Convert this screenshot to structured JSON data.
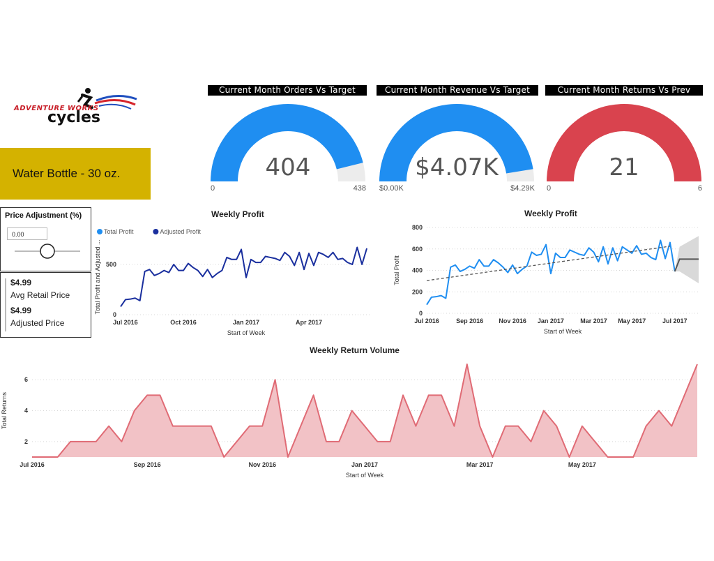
{
  "logo": {
    "line1": "ADVENTURE WORKS",
    "line2": "cycles"
  },
  "product": {
    "title": "Water Bottle - 30 oz."
  },
  "gauges": [
    {
      "title": "Current Month Orders Vs Target",
      "value_text": "404",
      "min_label": "0",
      "max_label": "438",
      "fraction": 0.922,
      "color": "#1f8ef1"
    },
    {
      "title": "Current Month Revenue Vs Target",
      "value_text": "$4.07K",
      "min_label": "$0.00K",
      "max_label": "$4.29K",
      "fraction": 0.949,
      "color": "#1f8ef1"
    },
    {
      "title": "Current Month Returns Vs Prev Month",
      "value_text": "21",
      "min_label": "0",
      "max_label": "6",
      "fraction": 1.0,
      "color": "#d9434e"
    }
  ],
  "slicer": {
    "title": "Price Adjustment (%)",
    "value": "0.00",
    "slider_position": 0.5
  },
  "card": {
    "avg_value": "$4.99",
    "avg_label": "Avg Retail Price",
    "adj_value": "$4.99",
    "adj_label": "Adjusted Price"
  },
  "chart_data": [
    {
      "type": "line",
      "title": "Weekly Profit",
      "xlabel": "Start of Week",
      "ylabel": "Total Profit and Adjusted ...",
      "legend": [
        "Total Profit",
        "Adjusted Profit"
      ],
      "legend_colors": [
        "#1f8ef1",
        "#1a2f9e"
      ],
      "legend_position": "top-left",
      "x_ticks": [
        "Jul 2016",
        "Oct 2016",
        "Jan 2017",
        "Apr 2017"
      ],
      "y_ticks": [
        "0",
        "500"
      ],
      "ylim": [
        0,
        750
      ],
      "x_range": [
        "2016-07-04",
        "2017-07-03"
      ],
      "series": [
        {
          "name": "Adjusted Profit",
          "color": "#1a2f9e",
          "x": [
            "2016-07-04",
            "2016-07-11",
            "2016-07-18",
            "2016-07-25",
            "2016-08-01",
            "2016-08-08",
            "2016-08-15",
            "2016-08-22",
            "2016-08-29",
            "2016-09-05",
            "2016-09-12",
            "2016-09-19",
            "2016-09-26",
            "2016-10-03",
            "2016-10-10",
            "2016-10-17",
            "2016-10-24",
            "2016-10-31",
            "2016-11-07",
            "2016-11-14",
            "2016-11-21",
            "2016-11-28",
            "2016-12-05",
            "2016-12-12",
            "2016-12-19",
            "2016-12-26",
            "2017-01-02",
            "2017-01-09",
            "2017-01-16",
            "2017-01-23",
            "2017-01-30",
            "2017-02-06",
            "2017-02-13",
            "2017-02-20",
            "2017-02-27",
            "2017-03-06",
            "2017-03-13",
            "2017-03-20",
            "2017-03-27",
            "2017-04-03",
            "2017-04-10",
            "2017-04-17",
            "2017-04-24",
            "2017-05-01",
            "2017-05-08",
            "2017-05-15",
            "2017-05-22",
            "2017-05-29",
            "2017-06-05",
            "2017-06-12",
            "2017-06-19",
            "2017-06-26"
          ],
          "values": [
            80,
            150,
            155,
            165,
            140,
            430,
            450,
            390,
            410,
            440,
            420,
            500,
            440,
            440,
            510,
            470,
            440,
            380,
            450,
            370,
            410,
            440,
            570,
            550,
            550,
            650,
            370,
            550,
            520,
            520,
            580,
            570,
            560,
            540,
            620,
            580,
            490,
            620,
            450,
            610,
            490,
            620,
            600,
            570,
            620,
            550,
            560,
            520,
            500,
            670,
            500,
            660
          ]
        }
      ]
    },
    {
      "type": "line",
      "title": "Weekly Profit",
      "xlabel": "Start of Week",
      "ylabel": "Total Profit",
      "x_ticks": [
        "Jul 2016",
        "Sep 2016",
        "Nov 2016",
        "Jan 2017",
        "Mar 2017",
        "May 2017",
        "Jul 2017"
      ],
      "y_ticks": [
        "0",
        "200",
        "400",
        "600",
        "800"
      ],
      "ylim": [
        0,
        800
      ],
      "x_range": [
        "2016-07-04",
        "2017-08-07"
      ],
      "series": [
        {
          "name": "Total Profit",
          "color": "#1f8ef1",
          "x": [
            "2016-07-04",
            "2016-07-11",
            "2016-07-18",
            "2016-07-25",
            "2016-08-01",
            "2016-08-08",
            "2016-08-15",
            "2016-08-22",
            "2016-08-29",
            "2016-09-05",
            "2016-09-12",
            "2016-09-19",
            "2016-09-26",
            "2016-10-03",
            "2016-10-10",
            "2016-10-17",
            "2016-10-24",
            "2016-10-31",
            "2016-11-07",
            "2016-11-14",
            "2016-11-21",
            "2016-11-28",
            "2016-12-05",
            "2016-12-12",
            "2016-12-19",
            "2016-12-26",
            "2017-01-02",
            "2017-01-09",
            "2017-01-16",
            "2017-01-23",
            "2017-01-30",
            "2017-02-06",
            "2017-02-13",
            "2017-02-20",
            "2017-02-27",
            "2017-03-06",
            "2017-03-13",
            "2017-03-20",
            "2017-03-27",
            "2017-04-03",
            "2017-04-10",
            "2017-04-17",
            "2017-04-24",
            "2017-05-01",
            "2017-05-08",
            "2017-05-15",
            "2017-05-22",
            "2017-05-29",
            "2017-06-05",
            "2017-06-12",
            "2017-06-19",
            "2017-06-26",
            "2017-07-03"
          ],
          "values": [
            80,
            150,
            155,
            165,
            140,
            430,
            450,
            390,
            410,
            440,
            420,
            500,
            440,
            440,
            500,
            470,
            430,
            380,
            450,
            370,
            410,
            440,
            570,
            540,
            550,
            640,
            370,
            560,
            520,
            520,
            590,
            570,
            550,
            540,
            610,
            570,
            480,
            620,
            460,
            610,
            490,
            620,
            590,
            560,
            630,
            550,
            560,
            520,
            500,
            680,
            510,
            660,
            390
          ]
        },
        {
          "name": "Trend",
          "style": "dashed",
          "color": "#555555",
          "x": [
            "2016-07-04",
            "2017-06-26"
          ],
          "values": [
            305,
            625
          ]
        },
        {
          "name": "Forecast",
          "color": "#555555",
          "x": [
            "2017-07-03",
            "2017-07-10",
            "2017-08-07"
          ],
          "values": [
            390,
            505,
            505
          ],
          "band_upper": [
            390,
            620,
            720
          ],
          "band_lower": [
            390,
            390,
            280
          ]
        }
      ]
    },
    {
      "type": "area",
      "title": "Weekly Return Volume",
      "xlabel": "Start of Week",
      "ylabel": "Total Returns",
      "x_ticks": [
        "Jul 2016",
        "Sep 2016",
        "Nov 2016",
        "Jan 2017",
        "Mar 2017",
        "May 2017"
      ],
      "y_ticks": [
        "2",
        "4",
        "6"
      ],
      "ylim": [
        1,
        7
      ],
      "x_range": [
        "2016-07-04",
        "2017-07-03"
      ],
      "series": [
        {
          "name": "Total Returns",
          "color": "#e06b75",
          "fill": "#f2c2c6",
          "x": [
            "2016-07-04",
            "2016-07-11",
            "2016-07-18",
            "2016-07-25",
            "2016-08-01",
            "2016-08-08",
            "2016-08-15",
            "2016-08-22",
            "2016-08-29",
            "2016-09-05",
            "2016-09-12",
            "2016-09-19",
            "2016-09-26",
            "2016-10-03",
            "2016-10-10",
            "2016-10-17",
            "2016-10-24",
            "2016-10-31",
            "2016-11-07",
            "2016-11-14",
            "2016-11-21",
            "2016-11-28",
            "2016-12-05",
            "2016-12-12",
            "2016-12-19",
            "2016-12-26",
            "2017-01-02",
            "2017-01-09",
            "2017-01-16",
            "2017-01-23",
            "2017-01-30",
            "2017-02-06",
            "2017-02-13",
            "2017-02-20",
            "2017-02-27",
            "2017-03-06",
            "2017-03-13",
            "2017-03-20",
            "2017-03-27",
            "2017-04-03",
            "2017-04-10",
            "2017-04-17",
            "2017-04-24",
            "2017-05-01",
            "2017-05-08",
            "2017-05-15",
            "2017-05-22",
            "2017-05-29",
            "2017-06-05",
            "2017-06-12",
            "2017-06-19",
            "2017-06-26",
            "2017-07-03"
          ],
          "values": [
            1,
            1,
            1,
            2,
            2,
            2,
            3,
            2,
            4,
            5,
            5,
            3,
            3,
            3,
            3,
            1,
            2,
            3,
            3,
            6,
            1,
            3,
            5,
            2,
            2,
            4,
            3,
            2,
            2,
            5,
            3,
            5,
            5,
            3,
            7,
            3,
            1,
            3,
            3,
            2,
            4,
            3,
            1,
            3,
            2,
            1,
            1,
            1,
            3,
            4,
            3,
            5,
            7
          ]
        }
      ]
    }
  ]
}
